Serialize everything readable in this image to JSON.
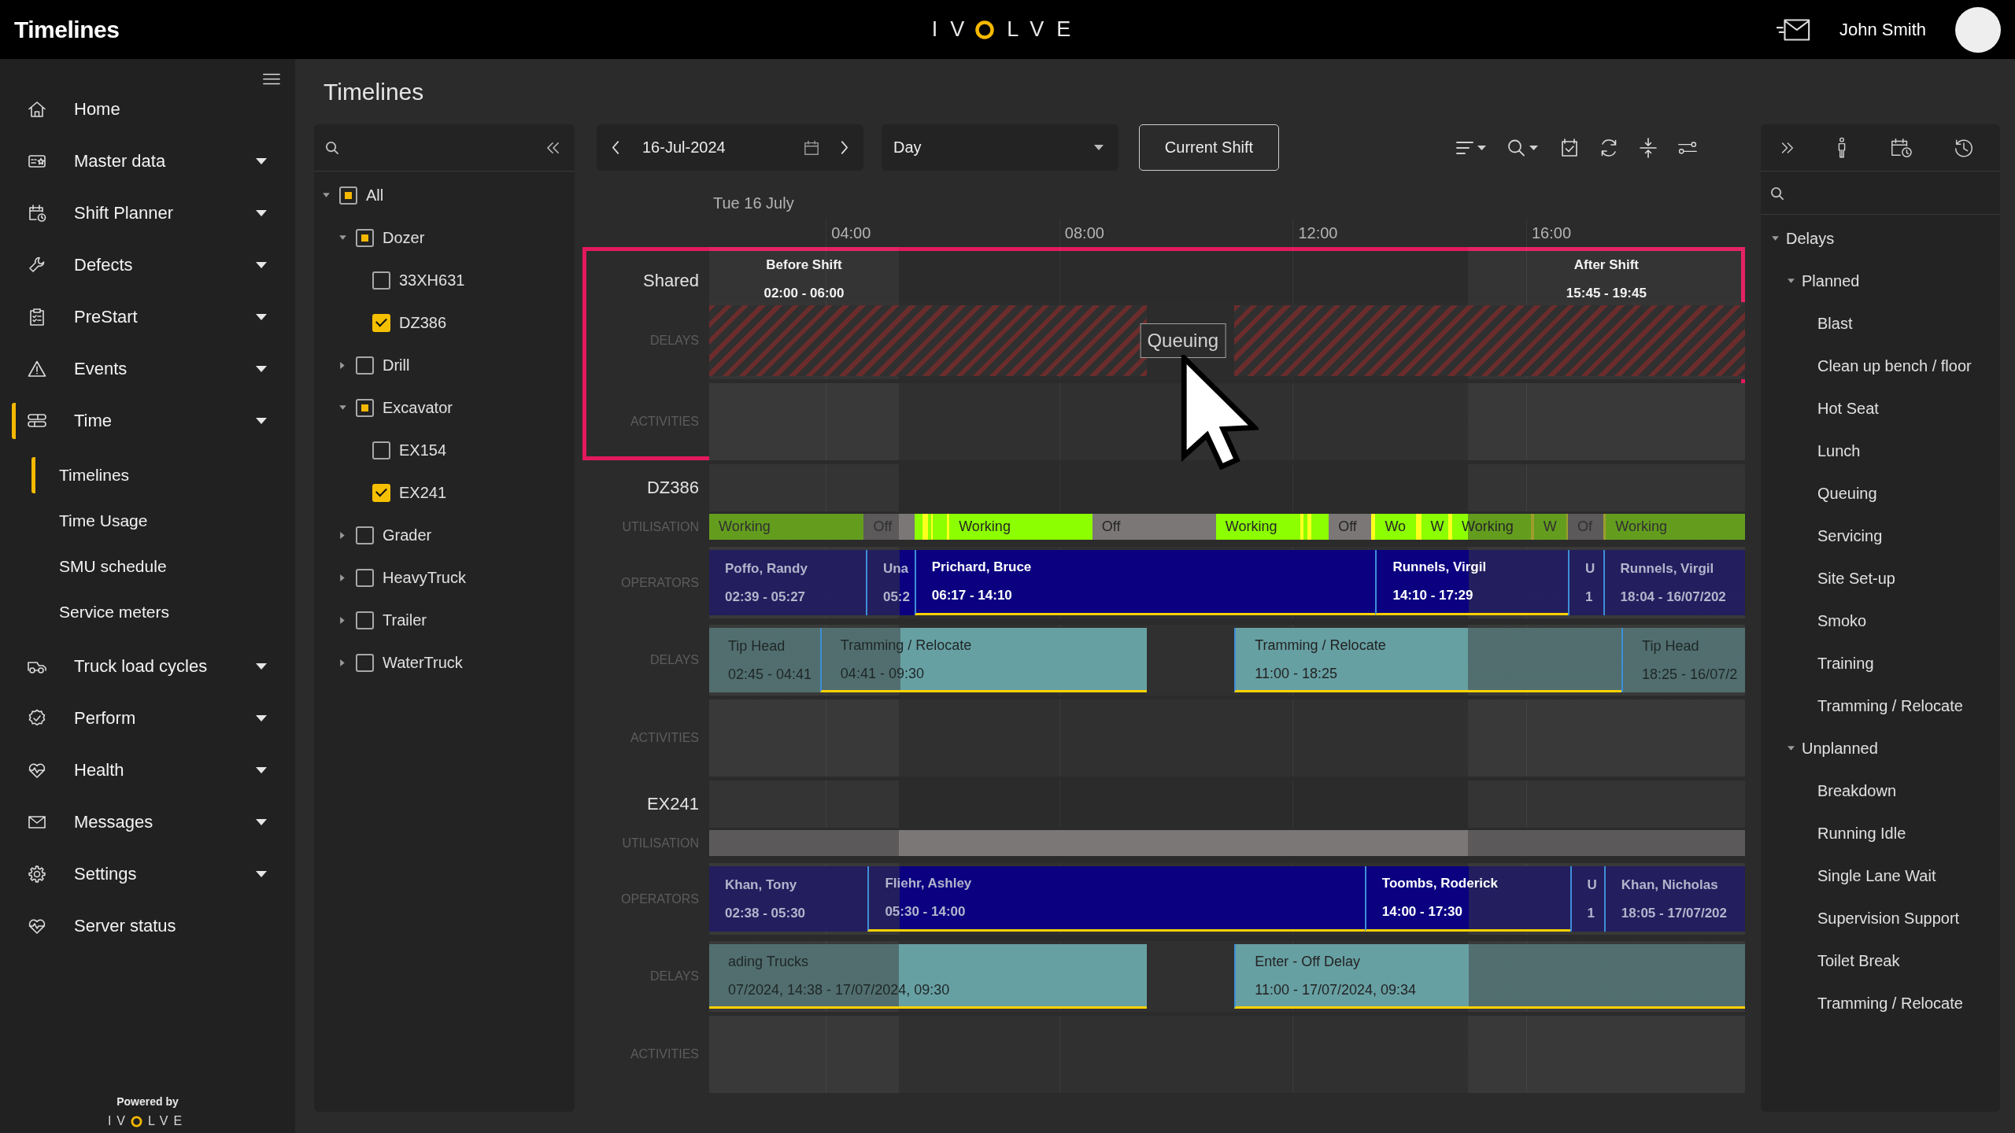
{
  "app_bar": {
    "title": "Timelines",
    "logo": {
      "left": "IV",
      "right": "LVE"
    },
    "user_name": "John Smith"
  },
  "sidebar": {
    "items": [
      {
        "label": "Home",
        "dropdown": false,
        "selected": false
      },
      {
        "label": "Master data",
        "dropdown": true,
        "selected": false
      },
      {
        "label": "Shift Planner",
        "dropdown": true,
        "selected": false
      },
      {
        "label": "Defects",
        "dropdown": true,
        "selected": false
      },
      {
        "label": "PreStart",
        "dropdown": true,
        "selected": false
      },
      {
        "label": "Events",
        "dropdown": true,
        "selected": false
      },
      {
        "label": "Time",
        "dropdown": true,
        "selected": true,
        "children": [
          {
            "label": "Timelines",
            "selected": true
          },
          {
            "label": "Time Usage",
            "selected": false
          },
          {
            "label": "SMU schedule",
            "selected": false
          },
          {
            "label": "Service meters",
            "selected": false
          }
        ]
      },
      {
        "label": "Truck load cycles",
        "dropdown": true,
        "selected": false
      },
      {
        "label": "Perform",
        "dropdown": true,
        "selected": false
      },
      {
        "label": "Health",
        "dropdown": true,
        "selected": false
      },
      {
        "label": "Messages",
        "dropdown": true,
        "selected": false
      },
      {
        "label": "Settings",
        "dropdown": true,
        "selected": false
      },
      {
        "label": "Server status",
        "dropdown": false,
        "selected": false
      }
    ],
    "footer": {
      "powered_by": "Powered by",
      "logo": {
        "left": "IV",
        "right": "LVE"
      }
    }
  },
  "page": {
    "title": "Timelines"
  },
  "equipment_tree": {
    "nodes": [
      {
        "label": "All",
        "expanded": true,
        "checked": false,
        "indeterminate": true,
        "children": [
          {
            "label": "Dozer",
            "expanded": true,
            "checked": false,
            "indeterminate": true,
            "children": [
              {
                "label": "33XH631",
                "checked": false,
                "indeterminate": false
              },
              {
                "label": "DZ386",
                "checked": true,
                "indeterminate": false
              }
            ]
          },
          {
            "label": "Drill",
            "expanded": false,
            "checked": false,
            "indeterminate": false
          },
          {
            "label": "Excavator",
            "expanded": true,
            "checked": false,
            "indeterminate": true,
            "children": [
              {
                "label": "EX154",
                "checked": false,
                "indeterminate": false
              },
              {
                "label": "EX241",
                "checked": true,
                "indeterminate": false
              }
            ]
          },
          {
            "label": "Grader",
            "expanded": false,
            "checked": false,
            "indeterminate": false
          },
          {
            "label": "HeavyTruck",
            "expanded": false,
            "checked": false,
            "indeterminate": false
          },
          {
            "label": "Trailer",
            "expanded": false,
            "checked": false,
            "indeterminate": false
          },
          {
            "label": "WaterTruck",
            "expanded": false,
            "checked": false,
            "indeterminate": false
          }
        ]
      }
    ]
  },
  "toolbar": {
    "date": "16-Jul-2024",
    "view": "Day",
    "current_shift_button": "Current Shift"
  },
  "timeline": {
    "date_label": "Tue 16 July",
    "ticks": [
      {
        "label": "04:00"
      },
      {
        "label": "08:00"
      },
      {
        "label": "12:00"
      },
      {
        "label": "16:00"
      }
    ],
    "groups": [
      {
        "name": "Shared",
        "highlighted": true,
        "bands": [
          {
            "title": "Before Shift",
            "times": "02:00 - 06:00"
          },
          {
            "title": "After Shift",
            "times": "15:45 - 19:45"
          }
        ],
        "lanes": [
          {
            "kind": "hatched",
            "label": "DELAYS",
            "tooltip": "Queuing"
          },
          {
            "kind": "activities",
            "label": "ACTIVITIES"
          }
        ]
      },
      {
        "name": "DZ386",
        "highlighted": false,
        "lanes": [
          {
            "kind": "utilisation",
            "label": "UTILISATION",
            "segments": [
              {
                "kind": "working",
                "label": "Working"
              },
              {
                "kind": "off",
                "label": "Off"
              },
              {
                "kind": "working"
              },
              {
                "kind": "marker"
              },
              {
                "kind": "working"
              },
              {
                "kind": "marker"
              },
              {
                "kind": "working"
              },
              {
                "kind": "marker"
              },
              {
                "kind": "working",
                "label": "Working"
              },
              {
                "kind": "off",
                "label": "Off"
              },
              {
                "kind": "working",
                "label": "Working"
              },
              {
                "kind": "marker"
              },
              {
                "kind": "working"
              },
              {
                "kind": "marker"
              },
              {
                "kind": "working"
              },
              {
                "kind": "off",
                "label": "Off"
              },
              {
                "kind": "marker"
              },
              {
                "kind": "working",
                "label": "Wo"
              },
              {
                "kind": "marker"
              },
              {
                "kind": "working",
                "label": "W"
              },
              {
                "kind": "marker"
              },
              {
                "kind": "working",
                "label": "Working"
              },
              {
                "kind": "marker"
              },
              {
                "kind": "working",
                "label": "W"
              },
              {
                "kind": "marker"
              },
              {
                "kind": "off",
                "label": "Of"
              },
              {
                "kind": "marker"
              },
              {
                "kind": "working",
                "label": "Working"
              }
            ]
          },
          {
            "kind": "operators",
            "label": "OPERATORS",
            "items": [
              {
                "title": "Poffo, Randy",
                "times": "02:39 - 05:27",
                "marked": false
              },
              {
                "title": "Una",
                "times": "05:2",
                "marked": false
              },
              {
                "title": "Prichard, Bruce",
                "times": "06:17 - 14:10",
                "marked": true
              },
              {
                "title": "Runnels, Virgil",
                "times": "14:10 - 17:29",
                "marked": true
              },
              {
                "title": "U",
                "times": "1",
                "marked": false
              },
              {
                "title": "Runnels, Virgil",
                "times": "18:04 - 16/07/202",
                "marked": false
              }
            ]
          },
          {
            "kind": "delays",
            "label": "DELAYS",
            "items": [
              {
                "title": "Tip Head",
                "times": "02:45 - 04:41",
                "marked": false
              },
              {
                "title": "Tramming / Relocate",
                "times": "04:41 - 09:30",
                "marked": true
              },
              {
                "title": "Tramming / Relocate",
                "times": "11:00 - 18:25",
                "marked": true
              },
              {
                "title": "Tip Head",
                "times": "18:25 - 16/07/2",
                "marked": false
              }
            ]
          },
          {
            "kind": "activities",
            "label": "ACTIVITIES"
          }
        ]
      },
      {
        "name": "EX241",
        "highlighted": false,
        "lanes": [
          {
            "kind": "utilisation",
            "label": "UTILISATION",
            "segments": [
              {
                "kind": "off"
              }
            ]
          },
          {
            "kind": "operators",
            "label": "OPERATORS",
            "items": [
              {
                "title": "Khan, Tony",
                "times": "02:38 - 05:30",
                "marked": false
              },
              {
                "title": "Fliehr, Ashley",
                "times": "05:30 - 14:00",
                "marked": true
              },
              {
                "title": "Toombs, Roderick",
                "times": "14:00 - 17:30",
                "marked": true
              },
              {
                "title": "U",
                "times": "1",
                "marked": false
              },
              {
                "title": "Khan, Nicholas",
                "times": "18:05 - 17/07/202",
                "marked": false
              }
            ]
          },
          {
            "kind": "delays",
            "label": "DELAYS",
            "items": [
              {
                "title": "ading Trucks",
                "times": "07/2024, 14:38 - 17/07/2024, 09:30",
                "marked": true
              },
              {
                "title": "Enter - Off Delay",
                "times": "11:00 - 17/07/2024, 09:34",
                "marked": true
              }
            ]
          },
          {
            "kind": "activities",
            "label": "ACTIVITIES"
          }
        ]
      }
    ]
  },
  "legend_panel": {
    "nodes": [
      {
        "label": "Delays",
        "expanded": true,
        "children": [
          {
            "label": "Planned",
            "expanded": true,
            "children": [
              {
                "label": "Blast"
              },
              {
                "label": "Clean up bench / floor"
              },
              {
                "label": "Hot Seat"
              },
              {
                "label": "Lunch"
              },
              {
                "label": "Queuing"
              },
              {
                "label": "Servicing"
              },
              {
                "label": "Site Set-up"
              },
              {
                "label": "Smoko"
              },
              {
                "label": "Training"
              },
              {
                "label": "Tramming / Relocate"
              }
            ]
          },
          {
            "label": "Unplanned",
            "expanded": true,
            "children": [
              {
                "label": "Breakdown"
              },
              {
                "label": "Running Idle"
              },
              {
                "label": "Single Lane Wait"
              },
              {
                "label": "Supervision Support"
              },
              {
                "label": "Toilet Break"
              },
              {
                "label": "Tramming / Relocate"
              }
            ]
          }
        ]
      }
    ]
  }
}
